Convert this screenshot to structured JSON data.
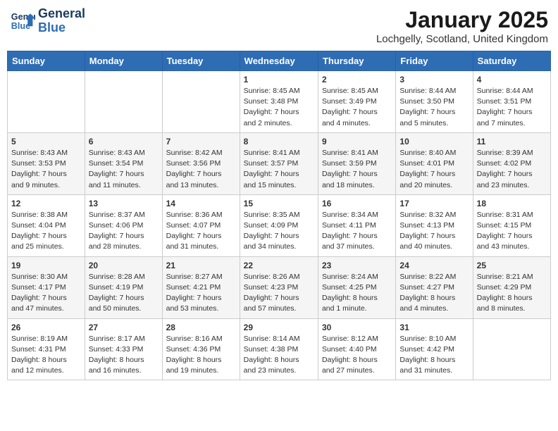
{
  "header": {
    "logo_line1": "General",
    "logo_line2": "Blue",
    "month": "January 2025",
    "location": "Lochgelly, Scotland, United Kingdom"
  },
  "weekdays": [
    "Sunday",
    "Monday",
    "Tuesday",
    "Wednesday",
    "Thursday",
    "Friday",
    "Saturday"
  ],
  "weeks": [
    [
      {
        "day": "",
        "info": ""
      },
      {
        "day": "",
        "info": ""
      },
      {
        "day": "",
        "info": ""
      },
      {
        "day": "1",
        "info": "Sunrise: 8:45 AM\nSunset: 3:48 PM\nDaylight: 7 hours\nand 2 minutes."
      },
      {
        "day": "2",
        "info": "Sunrise: 8:45 AM\nSunset: 3:49 PM\nDaylight: 7 hours\nand 4 minutes."
      },
      {
        "day": "3",
        "info": "Sunrise: 8:44 AM\nSunset: 3:50 PM\nDaylight: 7 hours\nand 5 minutes."
      },
      {
        "day": "4",
        "info": "Sunrise: 8:44 AM\nSunset: 3:51 PM\nDaylight: 7 hours\nand 7 minutes."
      }
    ],
    [
      {
        "day": "5",
        "info": "Sunrise: 8:43 AM\nSunset: 3:53 PM\nDaylight: 7 hours\nand 9 minutes."
      },
      {
        "day": "6",
        "info": "Sunrise: 8:43 AM\nSunset: 3:54 PM\nDaylight: 7 hours\nand 11 minutes."
      },
      {
        "day": "7",
        "info": "Sunrise: 8:42 AM\nSunset: 3:56 PM\nDaylight: 7 hours\nand 13 minutes."
      },
      {
        "day": "8",
        "info": "Sunrise: 8:41 AM\nSunset: 3:57 PM\nDaylight: 7 hours\nand 15 minutes."
      },
      {
        "day": "9",
        "info": "Sunrise: 8:41 AM\nSunset: 3:59 PM\nDaylight: 7 hours\nand 18 minutes."
      },
      {
        "day": "10",
        "info": "Sunrise: 8:40 AM\nSunset: 4:01 PM\nDaylight: 7 hours\nand 20 minutes."
      },
      {
        "day": "11",
        "info": "Sunrise: 8:39 AM\nSunset: 4:02 PM\nDaylight: 7 hours\nand 23 minutes."
      }
    ],
    [
      {
        "day": "12",
        "info": "Sunrise: 8:38 AM\nSunset: 4:04 PM\nDaylight: 7 hours\nand 25 minutes."
      },
      {
        "day": "13",
        "info": "Sunrise: 8:37 AM\nSunset: 4:06 PM\nDaylight: 7 hours\nand 28 minutes."
      },
      {
        "day": "14",
        "info": "Sunrise: 8:36 AM\nSunset: 4:07 PM\nDaylight: 7 hours\nand 31 minutes."
      },
      {
        "day": "15",
        "info": "Sunrise: 8:35 AM\nSunset: 4:09 PM\nDaylight: 7 hours\nand 34 minutes."
      },
      {
        "day": "16",
        "info": "Sunrise: 8:34 AM\nSunset: 4:11 PM\nDaylight: 7 hours\nand 37 minutes."
      },
      {
        "day": "17",
        "info": "Sunrise: 8:32 AM\nSunset: 4:13 PM\nDaylight: 7 hours\nand 40 minutes."
      },
      {
        "day": "18",
        "info": "Sunrise: 8:31 AM\nSunset: 4:15 PM\nDaylight: 7 hours\nand 43 minutes."
      }
    ],
    [
      {
        "day": "19",
        "info": "Sunrise: 8:30 AM\nSunset: 4:17 PM\nDaylight: 7 hours\nand 47 minutes."
      },
      {
        "day": "20",
        "info": "Sunrise: 8:28 AM\nSunset: 4:19 PM\nDaylight: 7 hours\nand 50 minutes."
      },
      {
        "day": "21",
        "info": "Sunrise: 8:27 AM\nSunset: 4:21 PM\nDaylight: 7 hours\nand 53 minutes."
      },
      {
        "day": "22",
        "info": "Sunrise: 8:26 AM\nSunset: 4:23 PM\nDaylight: 7 hours\nand 57 minutes."
      },
      {
        "day": "23",
        "info": "Sunrise: 8:24 AM\nSunset: 4:25 PM\nDaylight: 8 hours\nand 1 minute."
      },
      {
        "day": "24",
        "info": "Sunrise: 8:22 AM\nSunset: 4:27 PM\nDaylight: 8 hours\nand 4 minutes."
      },
      {
        "day": "25",
        "info": "Sunrise: 8:21 AM\nSunset: 4:29 PM\nDaylight: 8 hours\nand 8 minutes."
      }
    ],
    [
      {
        "day": "26",
        "info": "Sunrise: 8:19 AM\nSunset: 4:31 PM\nDaylight: 8 hours\nand 12 minutes."
      },
      {
        "day": "27",
        "info": "Sunrise: 8:17 AM\nSunset: 4:33 PM\nDaylight: 8 hours\nand 16 minutes."
      },
      {
        "day": "28",
        "info": "Sunrise: 8:16 AM\nSunset: 4:36 PM\nDaylight: 8 hours\nand 19 minutes."
      },
      {
        "day": "29",
        "info": "Sunrise: 8:14 AM\nSunset: 4:38 PM\nDaylight: 8 hours\nand 23 minutes."
      },
      {
        "day": "30",
        "info": "Sunrise: 8:12 AM\nSunset: 4:40 PM\nDaylight: 8 hours\nand 27 minutes."
      },
      {
        "day": "31",
        "info": "Sunrise: 8:10 AM\nSunset: 4:42 PM\nDaylight: 8 hours\nand 31 minutes."
      },
      {
        "day": "",
        "info": ""
      }
    ]
  ]
}
